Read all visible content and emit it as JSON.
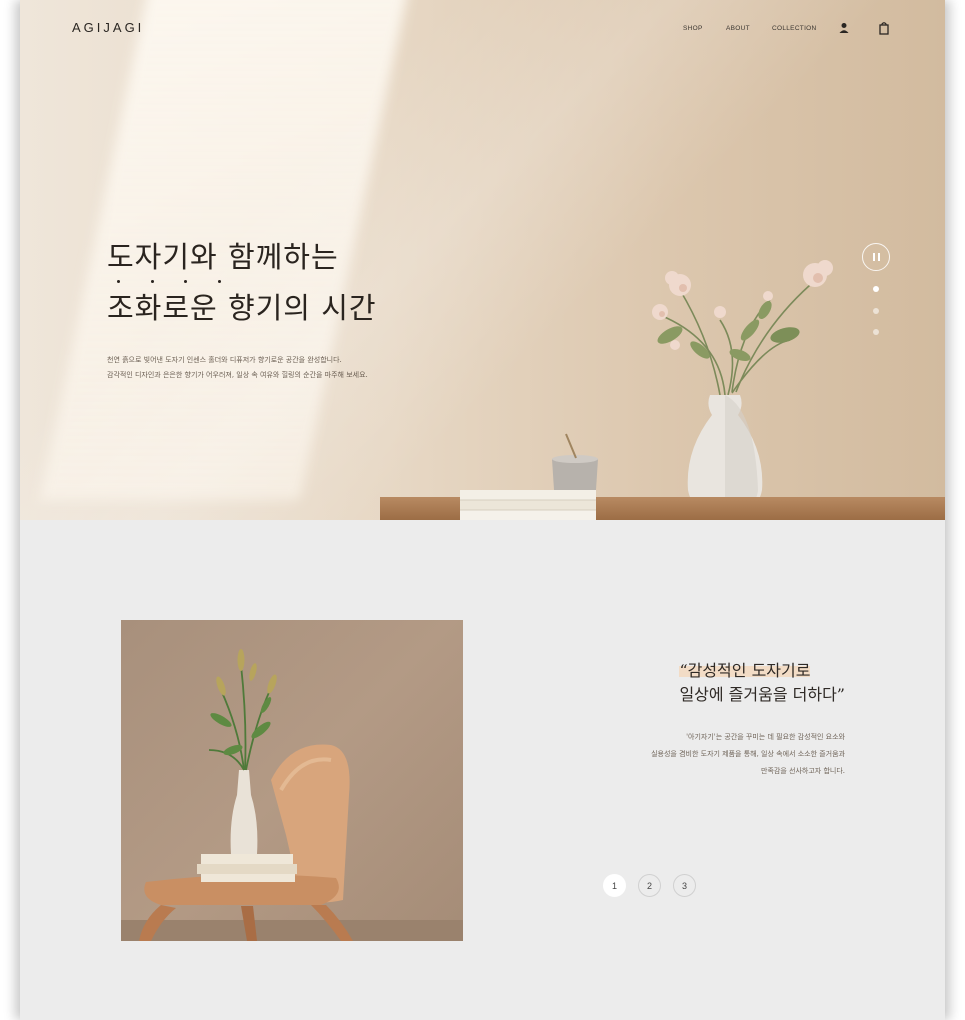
{
  "brand": {
    "logo": "AGIJAGI"
  },
  "nav": {
    "links": [
      "SHOP",
      "ABOUT",
      "COLLECTION"
    ],
    "icons": [
      "user-icon",
      "shopping-bag-icon"
    ]
  },
  "hero": {
    "title_line1": "도자기와 함께하는",
    "title_line2": "조화로운 향기의 시간",
    "desc_line1": "천연 흙으로 빚어낸 도자기 인센스 홀더와 디퓨저가 향기로운 공간을 완성합니다.",
    "desc_line2": "감각적인 디자인과 은은한 향기가 어우러져, 일상 속 여유와 힐링의 순간을 마주해 보세요.",
    "slides_total": 3,
    "slide_active": 1,
    "pause_icon": "pause-icon"
  },
  "feature": {
    "quote_line1": "“감성적인 도자기로",
    "quote_line2": "일상에 즐거움을 더하다”",
    "body_line1": "'아기자기'는 공간을 꾸미는 데 필요한 감성적인 요소와",
    "body_line2": "실용성을 겸비한 도자기 제품을 통해, 일상 속에서 소소한 즐거움과",
    "body_line3": "만족감을 선사하고자 합니다.",
    "pages": [
      "1",
      "2",
      "3"
    ],
    "page_active": "1"
  },
  "colors": {
    "accent_highlight": "#f2dcc6",
    "text_dark": "#2a241f",
    "section_bg": "#ececec"
  }
}
